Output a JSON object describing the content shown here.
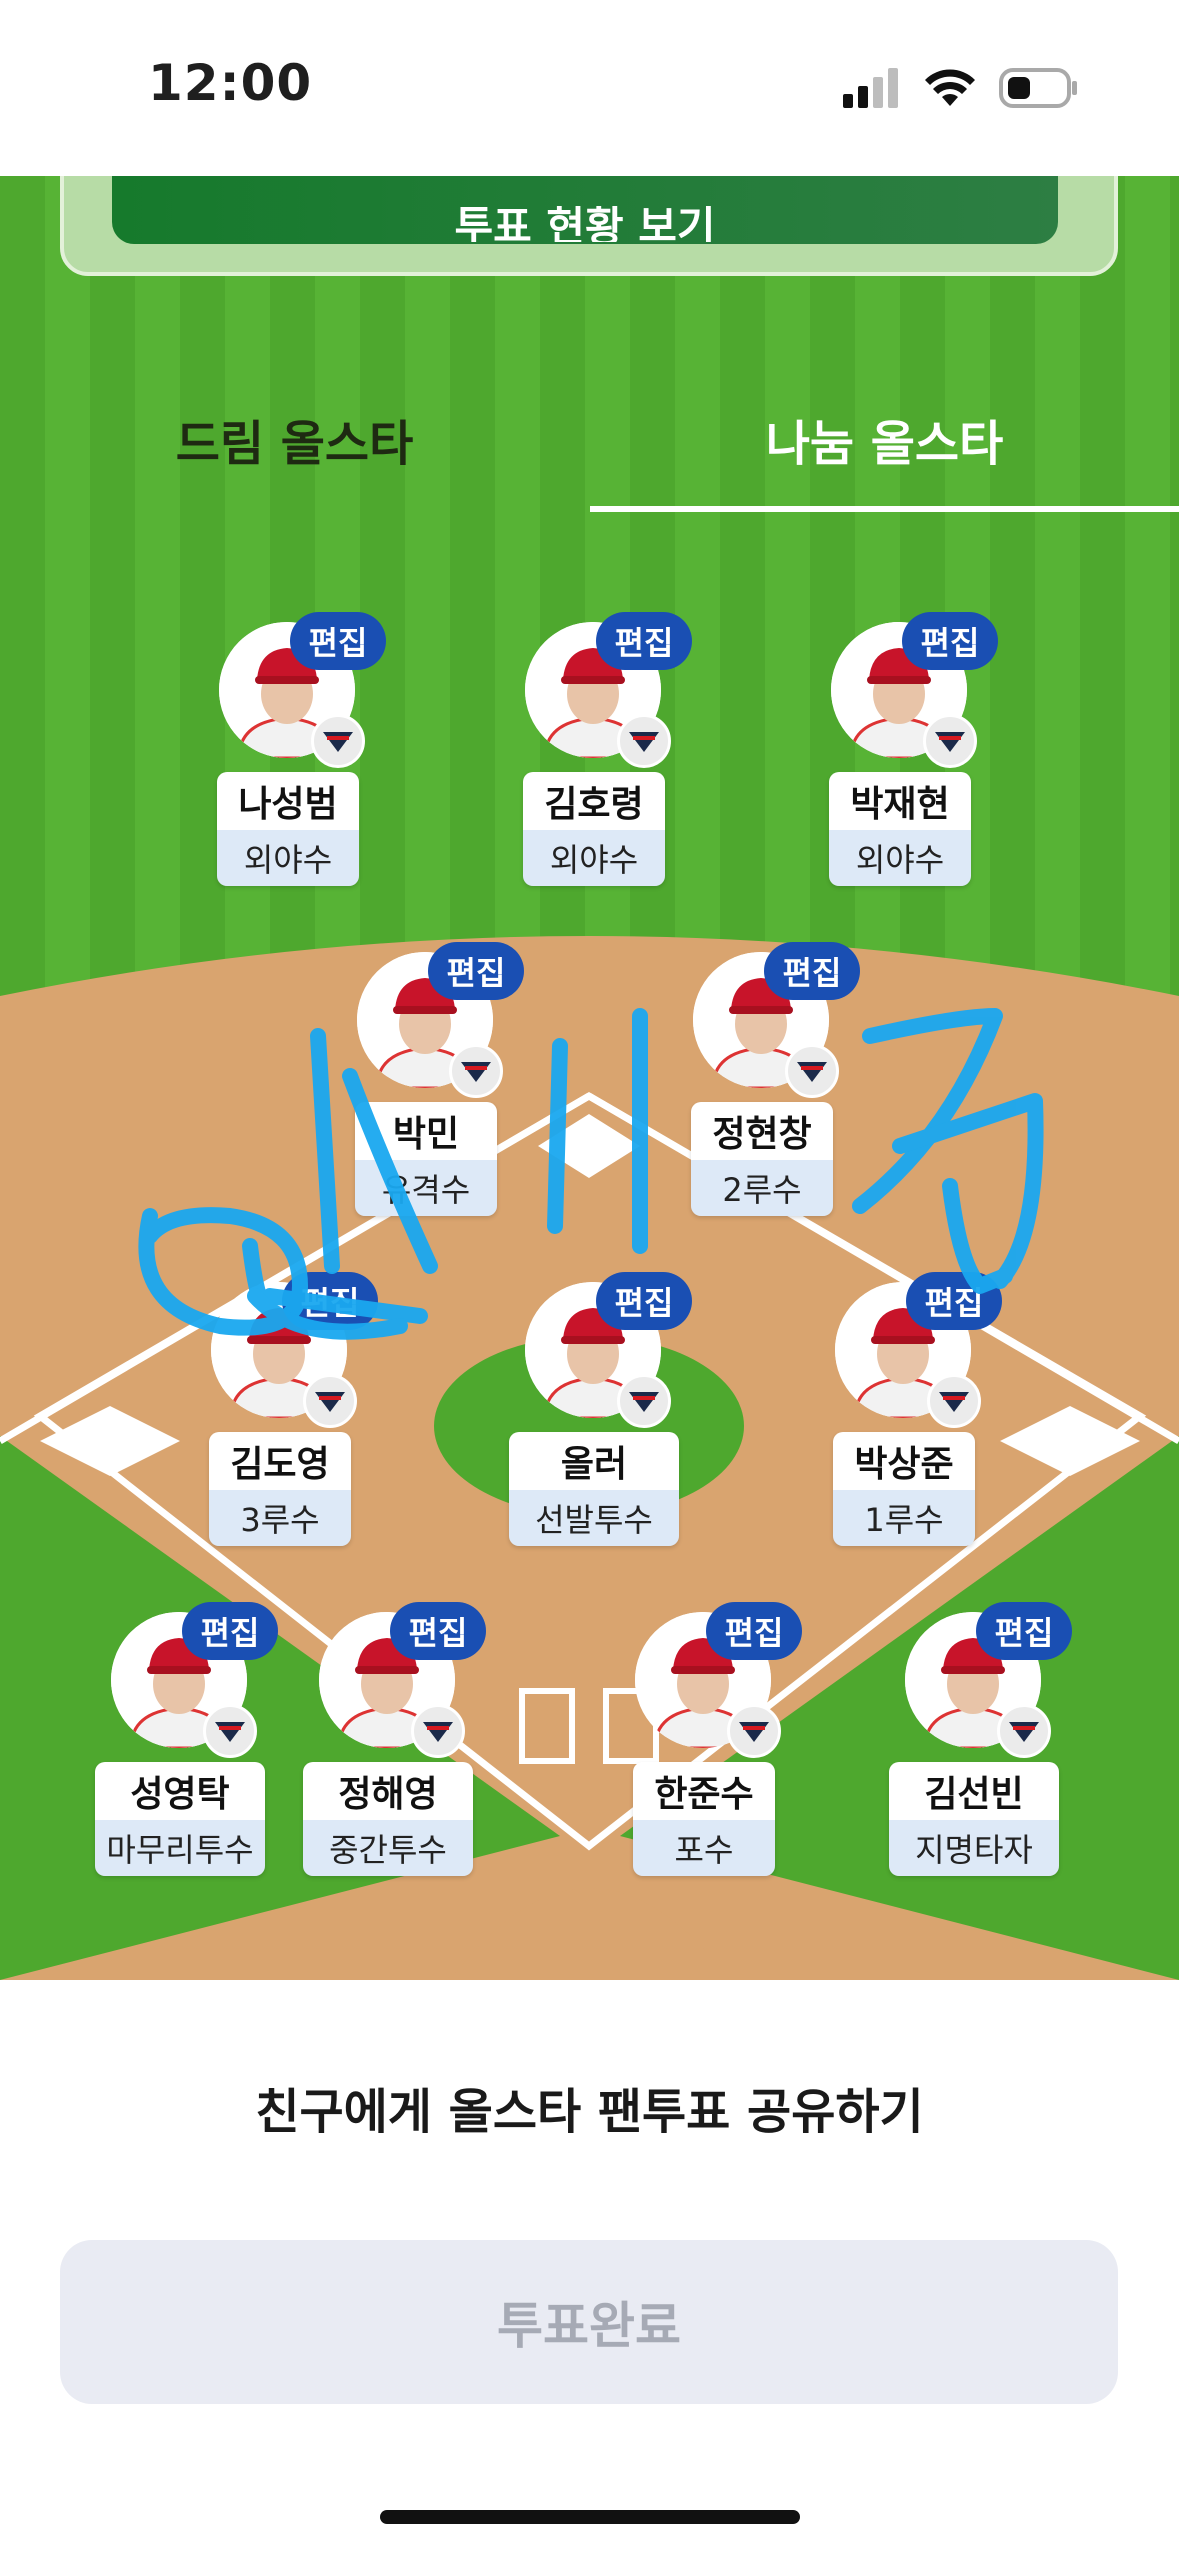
{
  "status_bar": {
    "time": "12:00",
    "icons": [
      "signal-icon",
      "wifi-icon",
      "battery-icon"
    ]
  },
  "summary": {
    "button_label": "투표 현황 보기"
  },
  "tabs": [
    {
      "label": "드림 올스타",
      "selected": false
    },
    {
      "label": "나눔 올스타",
      "selected": true
    }
  ],
  "lineup": {
    "edit_label": "편집",
    "team_logo_icon": "tigers-logo-icon",
    "players": [
      {
        "name": "나성범",
        "position": "외야수"
      },
      {
        "name": "김호령",
        "position": "외야수"
      },
      {
        "name": "박재현",
        "position": "외야수"
      },
      {
        "name": "박민",
        "position": "유격수"
      },
      {
        "name": "정현창",
        "position": "2루수"
      },
      {
        "name": "김도영",
        "position": "3루수"
      },
      {
        "name": "올러",
        "position": "선발투수"
      },
      {
        "name": "박상준",
        "position": "1루수"
      },
      {
        "name": "성영탁",
        "position": "마무리투수"
      },
      {
        "name": "정해영",
        "position": "중간투수"
      },
      {
        "name": "한준수",
        "position": "포수"
      },
      {
        "name": "김선빈",
        "position": "지명타자"
      }
    ]
  },
  "share": {
    "label": "친구에게 올스타 팬투표 공유하기"
  },
  "vote_button": {
    "label": "투표완료",
    "enabled": false
  },
  "colors": {
    "field_green": "#4ea82e",
    "infield_dirt": "#d9a46f",
    "badge_blue": "#1a4fb3",
    "position_bg": "#dde9f7",
    "scribble": "#1aa8f0"
  }
}
